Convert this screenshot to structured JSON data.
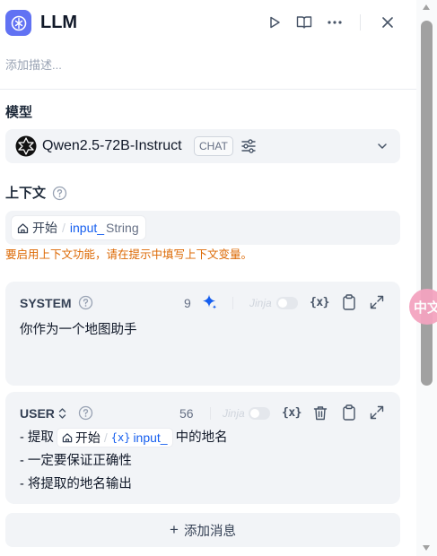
{
  "header": {
    "title": "LLM",
    "description_placeholder": "添加描述..."
  },
  "model": {
    "label": "模型",
    "name": "Qwen2.5-72B-Instruct",
    "mode_badge": "CHAT"
  },
  "context": {
    "label": "上下文",
    "variable": {
      "node": "开始",
      "name": "input_",
      "type": "String"
    },
    "warning": "要启用上下文功能，请在提示中填写上下文变量。"
  },
  "prompts": [
    {
      "role": "SYSTEM",
      "count": "9",
      "jinja_label": "Jinja",
      "var_label": "{x}",
      "lines": [
        "你作为一个地图助手"
      ]
    },
    {
      "role": "USER",
      "count": "56",
      "jinja_label": "Jinja",
      "var_label": "{x}",
      "line1_prefix": "- 提取",
      "line1_chip": {
        "node": "开始",
        "var_glyph": "{x}",
        "name": "input_"
      },
      "line1_suffix": "中的地名",
      "line2": "- 一定要保证正确性",
      "line3": "- 将提取的地名输出"
    }
  ],
  "add_message": {
    "plus": "+",
    "label": "添加消息"
  },
  "floating_button": {
    "label": "中文"
  },
  "colors": {
    "accent": "#6172f3",
    "link": "#155eef",
    "warning": "#dc6803",
    "card_bg": "#f2f4f7"
  }
}
